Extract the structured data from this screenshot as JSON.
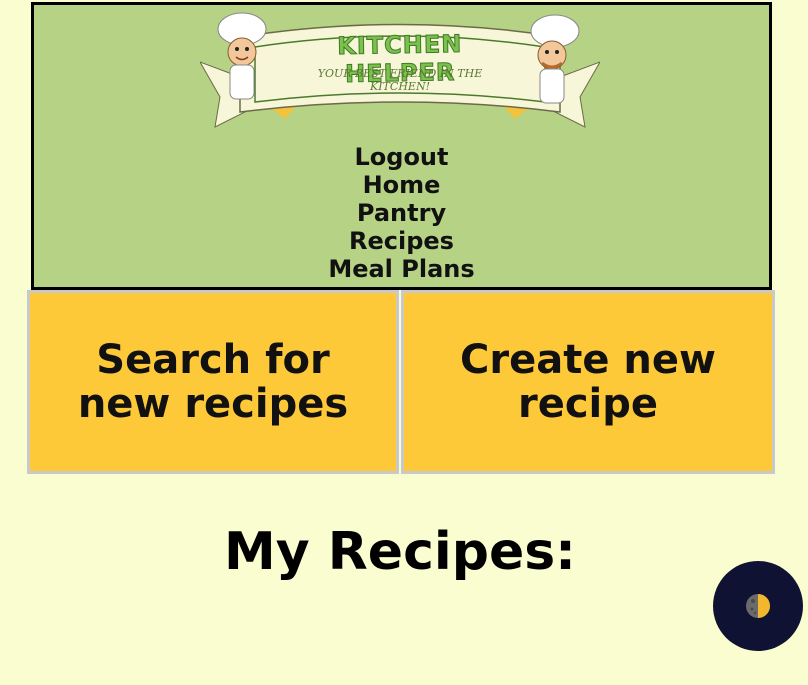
{
  "header": {
    "logo": {
      "title": "KITCHEN HELPER",
      "subtitle": "YOUR BEST FRIEND IN THE KITCHEN!"
    },
    "nav": [
      {
        "label": "Logout"
      },
      {
        "label": "Home"
      },
      {
        "label": "Pantry"
      },
      {
        "label": "Recipes"
      },
      {
        "label": "Meal Plans"
      }
    ]
  },
  "actions": {
    "search_label": "Search for new recipes",
    "create_label": "Create new recipe"
  },
  "main": {
    "title": "My Recipes:"
  },
  "theme_toggle": {
    "icon": "half-moon-icon"
  },
  "colors": {
    "background": "#fafdd0",
    "header": "#b6d285",
    "action": "#fec938",
    "toggle": "#0f1232"
  }
}
